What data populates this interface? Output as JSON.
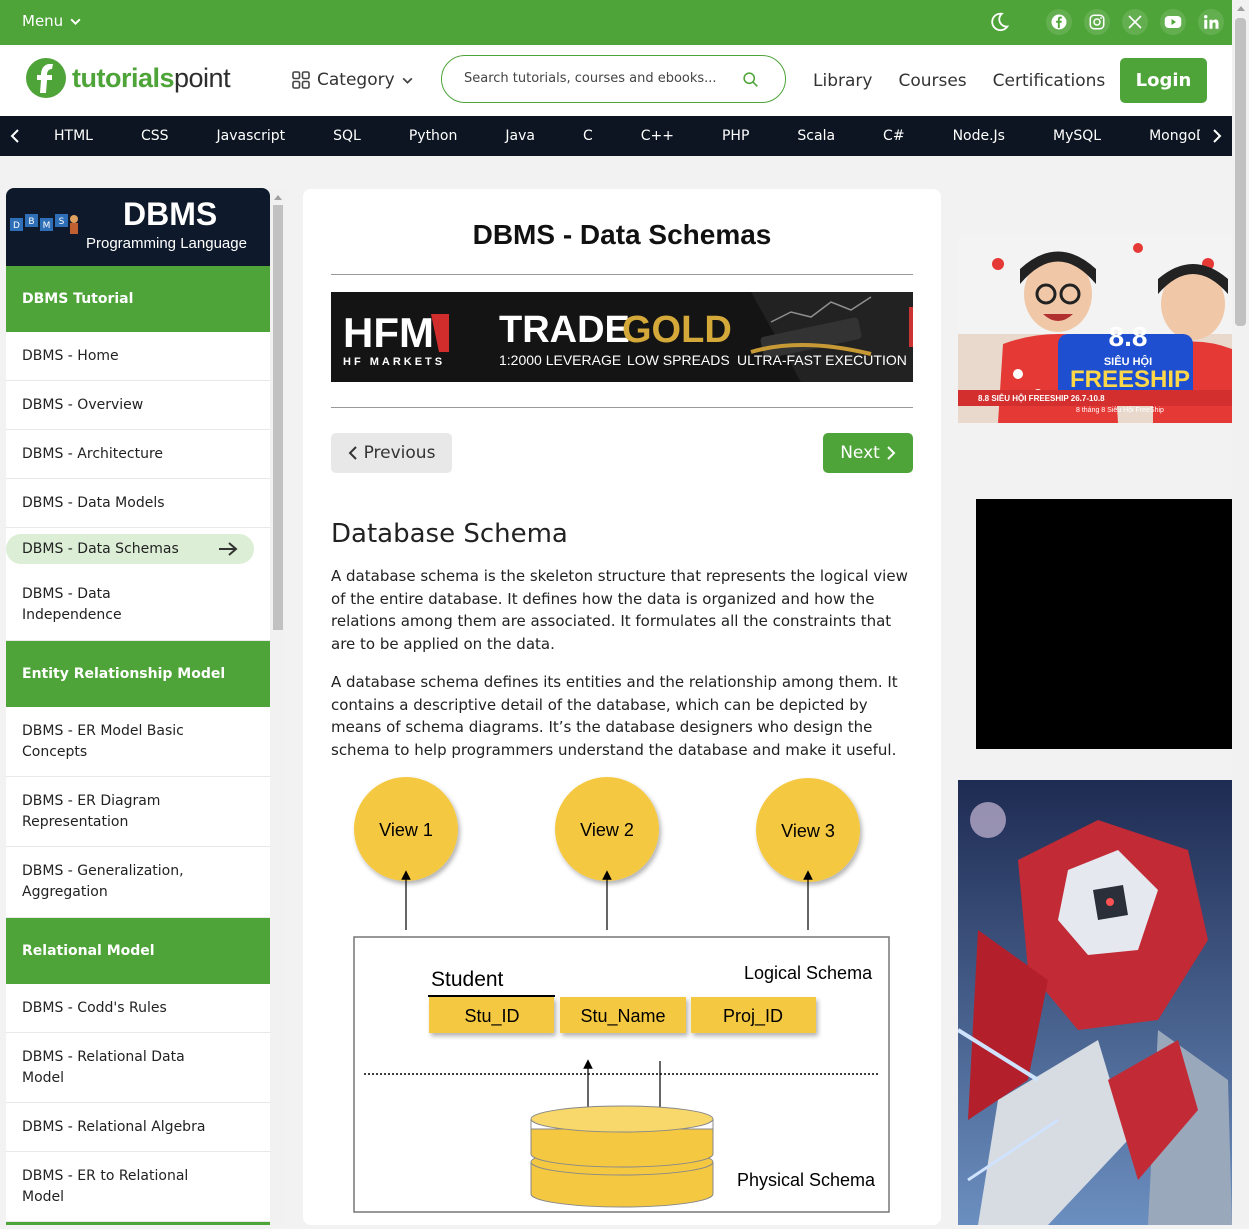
{
  "topbar": {
    "menu_label": "Menu",
    "icons": [
      "moon-icon",
      "facebook-icon",
      "instagram-icon",
      "x-icon",
      "youtube-icon",
      "linkedin-icon"
    ]
  },
  "header": {
    "logo_green": "tutorials",
    "logo_dark": "point",
    "category_label": "Category",
    "search_placeholder": "Search tutorials, courses and ebooks...",
    "nav": [
      "Library",
      "Courses",
      "Certifications"
    ],
    "login_label": "Login"
  },
  "languages": [
    "HTML",
    "CSS",
    "Javascript",
    "SQL",
    "Python",
    "Java",
    "C",
    "C++",
    "PHP",
    "Scala",
    "C#",
    "Node.Js",
    "MySQL",
    "MongoDB"
  ],
  "sidebar": {
    "banner_title": "DBMS",
    "banner_subtitle": "Programming Language",
    "banner_letters": [
      "D",
      "B",
      "M",
      "S"
    ],
    "sections": [
      {
        "title": "DBMS Tutorial",
        "items": [
          "DBMS - Home",
          "DBMS - Overview",
          "DBMS - Architecture",
          "DBMS - Data Models",
          "DBMS - Data Schemas",
          "DBMS - Data Independence"
        ]
      },
      {
        "title": "Entity Relationship Model",
        "items": [
          "DBMS - ER Model Basic Concepts",
          "DBMS - ER Diagram Representation",
          "DBMS - Generalization, Aggregation"
        ]
      },
      {
        "title": "Relational Model",
        "items": [
          "DBMS - Codd's Rules",
          "DBMS - Relational Data Model",
          "DBMS - Relational Algebra",
          "DBMS - ER to Relational Model"
        ]
      }
    ],
    "active_item": "DBMS - Data Schemas"
  },
  "content": {
    "title": "DBMS - Data Schemas",
    "ad": {
      "brand": "HFM",
      "brand_sub": "HF MARKETS",
      "headline_white": "TRADE",
      "headline_gold": "GOLD",
      "features": [
        "1:2000 LEVERAGE",
        "LOW SPREADS",
        "ULTRA-FAST EXECUTION"
      ]
    },
    "prev_label": "Previous",
    "next_label": "Next",
    "heading": "Database Schema",
    "paragraphs": [
      "A database schema is the skeleton structure that represents the logical view of the entire database. It defines how the data is organized and how the relations among them are associated. It formulates all the constraints that are to be applied on the data.",
      "A database schema defines its entities and the relationship among them. It contains a descriptive detail of the database, which can be depicted by means of schema diagrams. It’s the database designers who design the schema to help programmers understand the database and make it useful."
    ],
    "diagram": {
      "views": [
        "View 1",
        "View 2",
        "View 3"
      ],
      "table_name": "Student",
      "columns": [
        "Stu_ID",
        "Stu_Name",
        "Proj_ID"
      ],
      "logical_label": "Logical Schema",
      "physical_label": "Physical Schema"
    }
  },
  "right_ads": {
    "ad1_big": "8.8",
    "ad1_sub": "SIÊU HỘI",
    "ad1_brand": "FREESHIP",
    "ad1_footer": "8.8 SIÊU HỘI FREESHIP 26.7-10.8",
    "ad1_footer2": "8 tháng 8 Siêu Hội FreeShip"
  },
  "colors": {
    "brand_green": "#4ea438",
    "lang_bar": "#0c1521",
    "view_yellow": "#f5c842",
    "gold": "#d4a93a"
  }
}
